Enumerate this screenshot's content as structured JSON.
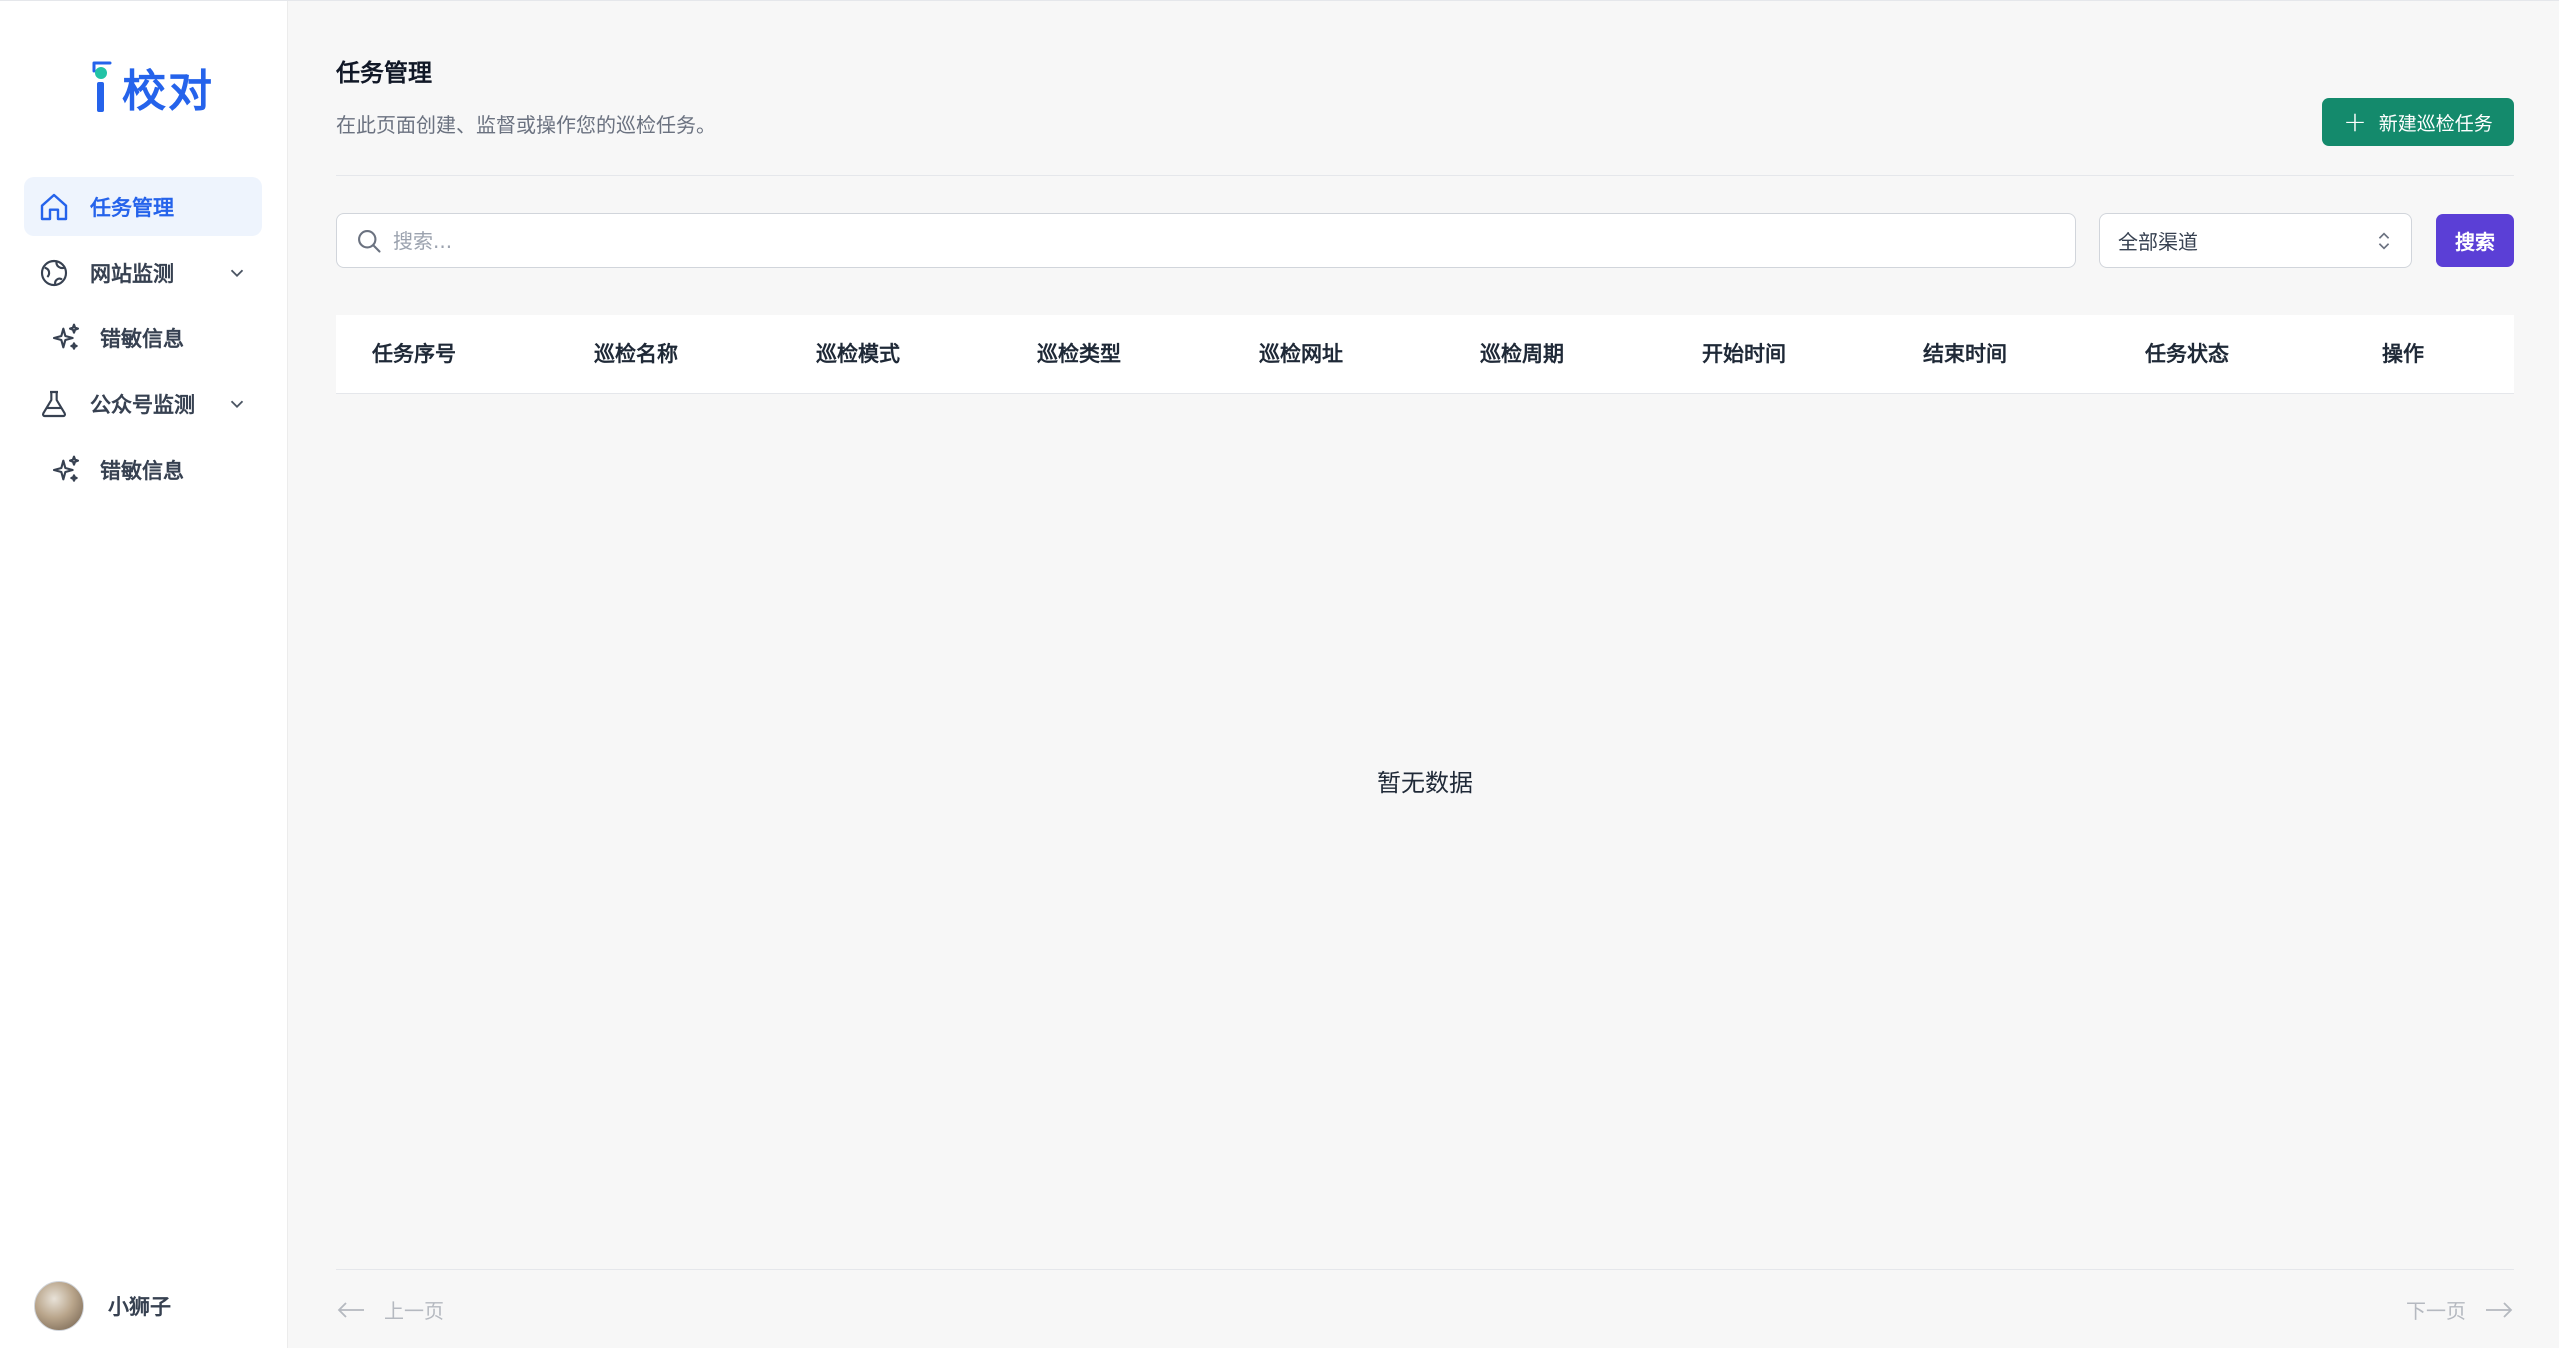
{
  "app": {
    "logo_text": "校对"
  },
  "sidebar": {
    "items": [
      {
        "label": "任务管理",
        "icon": "home-icon",
        "active": true
      },
      {
        "label": "网站监测",
        "icon": "globe-icon",
        "expandable": true
      },
      {
        "label": "错敏信息",
        "icon": "sparkles-icon",
        "sub": true
      },
      {
        "label": "公众号监测",
        "icon": "flask-icon",
        "expandable": true
      },
      {
        "label": "错敏信息",
        "icon": "sparkles-icon",
        "sub": true
      }
    ],
    "user": {
      "name": "小狮子"
    }
  },
  "header": {
    "title": "任务管理",
    "description": "在此页面创建、监督或操作您的巡检任务。",
    "new_button_label": "新建巡检任务"
  },
  "filters": {
    "search_placeholder": "搜索...",
    "channel_selected": "全部渠道",
    "search_button_label": "搜索"
  },
  "table": {
    "columns": [
      "任务序号",
      "巡检名称",
      "巡检模式",
      "巡检类型",
      "巡检网址",
      "巡检周期",
      "开始时间",
      "结束时间",
      "任务状态",
      "操作"
    ],
    "rows": [],
    "empty_text": "暂无数据"
  },
  "pagination": {
    "prev_label": "上一页",
    "next_label": "下一页"
  },
  "colors": {
    "primary_blue": "#2563eb",
    "new_button_green": "#148a6c",
    "search_button_purple": "#5b3fd6",
    "active_nav_bg": "#eef4fd"
  }
}
